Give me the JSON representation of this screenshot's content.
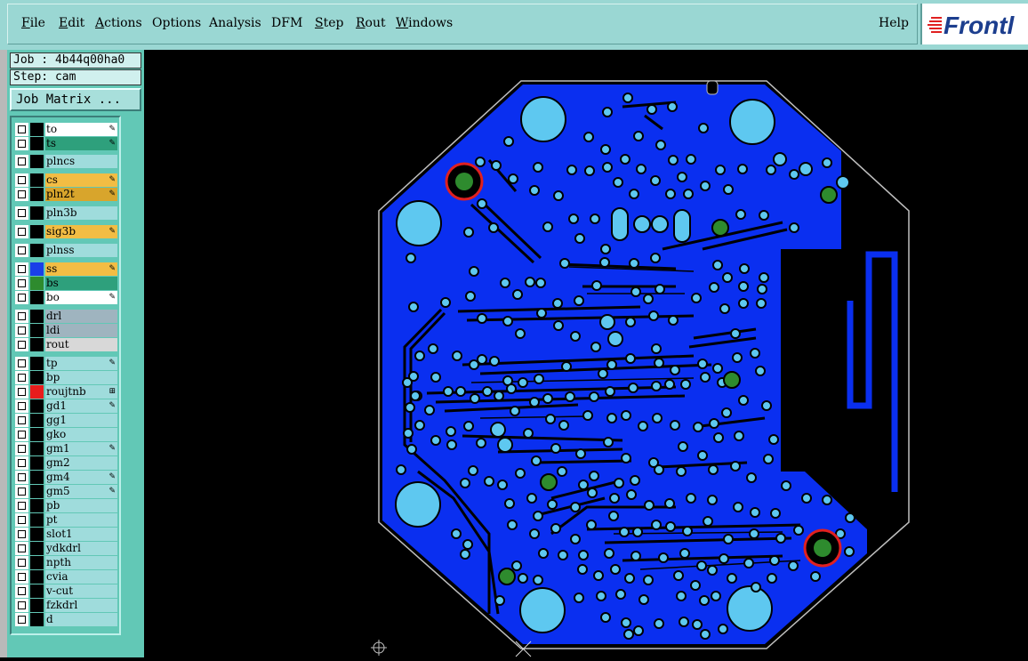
{
  "menu": {
    "file": "File",
    "edit": "Edit",
    "actions": "Actions",
    "options": "Options",
    "analysis": "Analysis",
    "dfm": "DFM",
    "step": "Step",
    "rout": "Rout",
    "windows": "Windows",
    "help": "Help"
  },
  "logo": {
    "text": "Frontl"
  },
  "job": {
    "job_label": "Job : 4b44q00ha0",
    "step_label": "Step: cam",
    "matrix_button": "Job Matrix ..."
  },
  "layers": [
    {
      "name": "to",
      "swatch": "#000000",
      "bg": "#ffffff",
      "edit": "✎"
    },
    {
      "name": "ts",
      "swatch": "#000000",
      "bg": "#2ea07c",
      "edit": "✎"
    },
    {
      "name": "plncs",
      "swatch": "#000000",
      "bg": "#9fdcdc",
      "edit": ""
    },
    {
      "name": "cs",
      "swatch": "#000000",
      "bg": "#f2bd44",
      "edit": "✎"
    },
    {
      "name": "pln2t",
      "swatch": "#000000",
      "bg": "#d8a52c",
      "edit": "✎"
    },
    {
      "name": "pln3b",
      "swatch": "#000000",
      "bg": "#9fdcdc",
      "edit": ""
    },
    {
      "name": "sig3b",
      "swatch": "#000000",
      "bg": "#f2bd44",
      "edit": "✎"
    },
    {
      "name": "plnss",
      "swatch": "#000000",
      "bg": "#9fdcdc",
      "edit": ""
    },
    {
      "name": "ss",
      "swatch": "#1a3fe8",
      "bg": "#f2bd44",
      "edit": "✎"
    },
    {
      "name": "bs",
      "swatch": "#2e8b2e",
      "bg": "#2ea07c",
      "edit": ""
    },
    {
      "name": "bo",
      "swatch": "#000000",
      "bg": "#ffffff",
      "edit": "✎"
    },
    {
      "name": "drl",
      "swatch": "#000000",
      "bg": "#9fb4bf",
      "edit": ""
    },
    {
      "name": "ldi",
      "swatch": "#000000",
      "bg": "#9fb4bf",
      "edit": ""
    },
    {
      "name": "rout",
      "swatch": "#000000",
      "bg": "#d8d8d8",
      "edit": ""
    },
    {
      "name": "tp",
      "swatch": "#000000",
      "bg": "#9fdcdc",
      "edit": "✎"
    },
    {
      "name": "bp",
      "swatch": "#000000",
      "bg": "#9fdcdc",
      "edit": ""
    },
    {
      "name": "roujtnb",
      "swatch": "#e81c1c",
      "bg": "#9fdcdc",
      "edit": "⊞"
    },
    {
      "name": "gd1",
      "swatch": "#000000",
      "bg": "#9fdcdc",
      "edit": "✎"
    },
    {
      "name": "gg1",
      "swatch": "#000000",
      "bg": "#9fdcdc",
      "edit": ""
    },
    {
      "name": "gko",
      "swatch": "#000000",
      "bg": "#9fdcdc",
      "edit": ""
    },
    {
      "name": "gm1",
      "swatch": "#000000",
      "bg": "#9fdcdc",
      "edit": "✎"
    },
    {
      "name": "gm2",
      "swatch": "#000000",
      "bg": "#9fdcdc",
      "edit": ""
    },
    {
      "name": "gm4",
      "swatch": "#000000",
      "bg": "#9fdcdc",
      "edit": "✎"
    },
    {
      "name": "gm5",
      "swatch": "#000000",
      "bg": "#9fdcdc",
      "edit": "✎"
    },
    {
      "name": "pb",
      "swatch": "#000000",
      "bg": "#9fdcdc",
      "edit": ""
    },
    {
      "name": "pt",
      "swatch": "#000000",
      "bg": "#9fdcdc",
      "edit": ""
    },
    {
      "name": "slot1",
      "swatch": "#000000",
      "bg": "#9fdcdc",
      "edit": ""
    },
    {
      "name": "ydkdrl",
      "swatch": "#000000",
      "bg": "#9fdcdc",
      "edit": ""
    },
    {
      "name": "npth",
      "swatch": "#000000",
      "bg": "#9fdcdc",
      "edit": ""
    },
    {
      "name": "cvia",
      "swatch": "#000000",
      "bg": "#9fdcdc",
      "edit": ""
    },
    {
      "name": "v-cut",
      "swatch": "#000000",
      "bg": "#9fdcdc",
      "edit": ""
    },
    {
      "name": "fzkdrl",
      "swatch": "#000000",
      "bg": "#9fdcdc",
      "edit": ""
    },
    {
      "name": "d",
      "swatch": "#000000",
      "bg": "#9fdcdc",
      "edit": ""
    }
  ],
  "colors": {
    "menubar": "#9ad7d3",
    "sidebar": "#62c8b6",
    "board_fill": "#0a2ff0",
    "pad": "#5ec8f0",
    "trace": "#000000",
    "green_pad": "#2e8b2e",
    "red_ring": "#e02020"
  }
}
